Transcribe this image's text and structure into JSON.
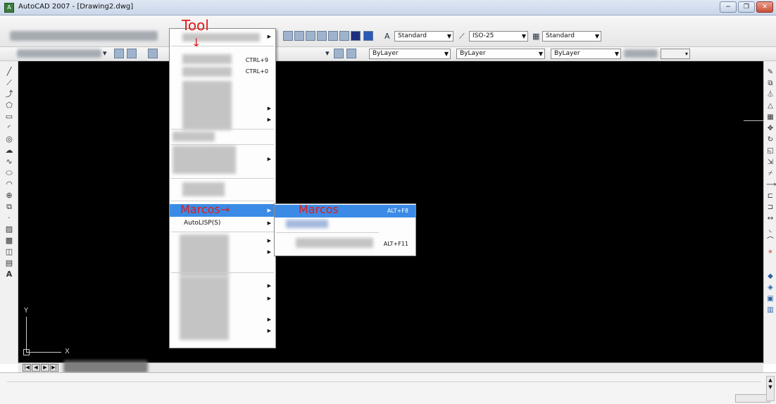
{
  "window": {
    "title": "AutoCAD 2007 - [Drawing2.dwg]",
    "app_icon": "autocad-logo-icon",
    "controls": [
      "−",
      "❐",
      "✕"
    ],
    "inner_controls": [
      "−",
      "❐",
      "✕"
    ]
  },
  "toolbar": {
    "text_style": "Standard",
    "dim_style": "ISO-25",
    "table_style": "Standard",
    "color": "ByLayer",
    "linetype": "ByLayer",
    "lineweight": "ByLayer"
  },
  "tools_menu": {
    "shortcuts": {
      "first": "CTRL+9",
      "second": "CTRL+0"
    },
    "macros_label": "Marcos",
    "autolisp_label": "AutoLISP(S)"
  },
  "macros_submenu": {
    "first_shortcut": "ALT+F8",
    "third_shortcut": "ALT+F11"
  },
  "annotations": {
    "tool": "Tool",
    "arrow_down": "↓",
    "marcos_arrow": "Marcos→",
    "marcos_sub": "Marcos"
  },
  "ucs": {
    "x_label": "X",
    "y_label": "Y"
  },
  "colors": {
    "canvas": "#000000",
    "menu_highlight": "#3b8be6",
    "annotation": "#e21b1b"
  }
}
